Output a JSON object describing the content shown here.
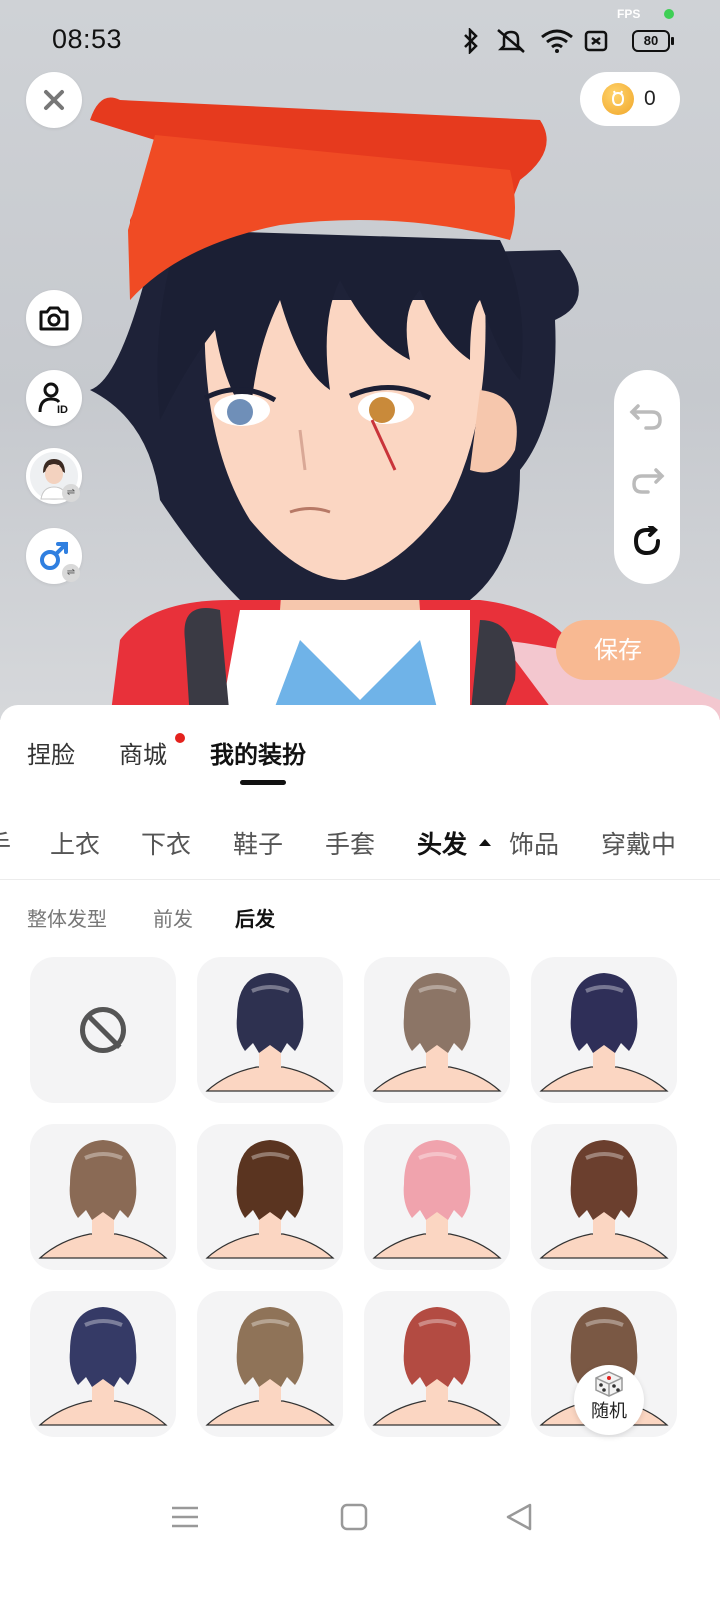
{
  "status_bar": {
    "time": "08:53",
    "fps_label": "FPS",
    "battery": "80"
  },
  "header": {
    "coin_count": "0"
  },
  "editor": {
    "save_label": "保存"
  },
  "main_tabs": [
    {
      "label": "捏脸",
      "active": false
    },
    {
      "label": "商城",
      "active": false,
      "badge": true
    },
    {
      "label": "我的装扮",
      "active": true
    }
  ],
  "category_tabs": [
    {
      "label": "手",
      "active": false
    },
    {
      "label": "上衣",
      "active": false
    },
    {
      "label": "下衣",
      "active": false
    },
    {
      "label": "鞋子",
      "active": false
    },
    {
      "label": "手套",
      "active": false
    },
    {
      "label": "头发",
      "active": true
    },
    {
      "label": "饰品",
      "active": false
    },
    {
      "label": "穿戴中",
      "active": false
    }
  ],
  "sub_tabs": [
    {
      "label": "整体发型",
      "active": false
    },
    {
      "label": "前发",
      "active": false
    },
    {
      "label": "后发",
      "active": true
    }
  ],
  "hair_items": [
    {
      "type": "none",
      "icon": "no-entry-icon"
    },
    {
      "color": "#2e3150"
    },
    {
      "color": "#8c7566"
    },
    {
      "color": "#2f2f58"
    },
    {
      "color": "#8a6a55"
    },
    {
      "color": "#5a3420"
    },
    {
      "color": "#f0a3ad"
    },
    {
      "color": "#6b3f2e"
    },
    {
      "color": "#353a66"
    },
    {
      "color": "#8f7358"
    },
    {
      "color": "#b34b42"
    },
    {
      "color": "#7a5844"
    }
  ],
  "random_button": {
    "label": "随机",
    "icon": "dice-icon"
  },
  "colors": {
    "accent": "#f8b992",
    "badge": "#e4221d",
    "skin": "#fbd6c2"
  }
}
